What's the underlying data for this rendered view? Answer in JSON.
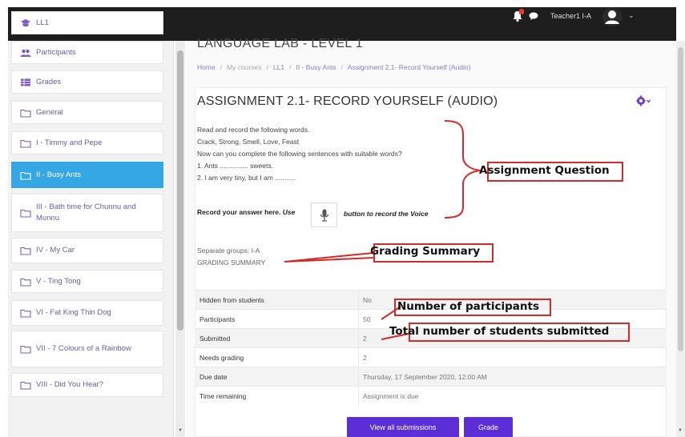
{
  "topbar": {
    "close_glyph": "✕",
    "user_name": "Teacher1 I-A",
    "caret": "⌄",
    "accent": "#1e1e1e"
  },
  "sidebar": {
    "items": [
      {
        "label": "LL1",
        "icon": "graduation-cap-icon"
      },
      {
        "label": "Participants",
        "icon": "users-icon"
      },
      {
        "label": "Grades",
        "icon": "table-icon"
      },
      {
        "label": "General",
        "icon": "folder-icon"
      },
      {
        "label": "I - Timmy and Pepe",
        "icon": "folder-icon"
      },
      {
        "label": "II - Busy Ants",
        "icon": "folder-icon",
        "active": true
      },
      {
        "label": "III - Bath time for Chunnu and Munnu",
        "icon": "folder-icon"
      },
      {
        "label": "IV - My Car",
        "icon": "folder-icon"
      },
      {
        "label": "V - Ting Tong",
        "icon": "folder-icon"
      },
      {
        "label": "VI - Fat King Thin Dog",
        "icon": "folder-icon"
      },
      {
        "label": "VII - 7 Colours of a Rainbow",
        "icon": "folder-icon"
      },
      {
        "label": "VIII - Did You Hear?",
        "icon": "folder-icon"
      }
    ],
    "active_color": "#35a7e4",
    "link_color": "#6b5ca5"
  },
  "main": {
    "course_title": "LANGUAGE LAB - LEVEL 1",
    "breadcrumb": {
      "home": "Home",
      "my_courses": "My courses",
      "course": "LL1",
      "section": "II - Busy Ants",
      "current": "Assignment 2.1- Record Yourself (Audio)"
    },
    "assignment_title": "ASSIGNMENT 2.1- RECORD YOURSELF (AUDIO)",
    "intro": {
      "line1": "Read and record the following words.",
      "line2": "Crack, Strong, Smell, Love, Feast",
      "line3": "Now can you complete the following sentences with suitable words?",
      "line4": "1. Ants ............... sweets.",
      "line5": "2. I am very tiny, but I am ..........."
    },
    "record": {
      "prefix_bold": "Record your answer here.",
      "prefix_italic": "Use",
      "suffix": "button to record the Voice"
    },
    "separate_groups": "Separate groups: I-A",
    "grading_summary_heading": "GRADING SUMMARY",
    "grading_table": [
      {
        "label": "Hidden from students",
        "value": "No"
      },
      {
        "label": "Participants",
        "value": "50"
      },
      {
        "label": "Submitted",
        "value": "2"
      },
      {
        "label": "Needs grading",
        "value": "2"
      },
      {
        "label": "Due date",
        "value": "Thursday, 17 September 2020, 12:00 AM"
      },
      {
        "label": "Time remaining",
        "value": "Assignment is due"
      }
    ],
    "buttons": {
      "view_all": "View all submissions",
      "grade": "Grade"
    },
    "button_color": "#5b2ed8"
  },
  "annotations": {
    "assignment_question": "Assignment Question",
    "grading_summary": "Grading Summary",
    "number_of_participants": "Number of participants",
    "total_submitted": "Total number of students submitted",
    "color": "#d42a2a"
  }
}
